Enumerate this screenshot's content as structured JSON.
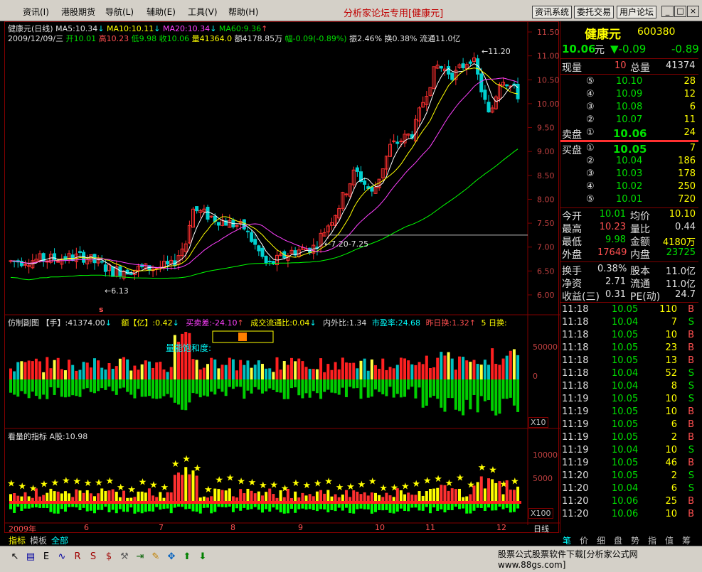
{
  "menu": {
    "items": [
      "资讯(I)",
      "港股期货",
      "导航(L)",
      "辅助(E)",
      "工具(V)",
      "帮助(H)"
    ],
    "app_title": "分析家论坛专用",
    "app_title_stock": "[健康元]",
    "buttons": [
      "资讯系统",
      "委托交易",
      "用户论坛"
    ],
    "win_controls": [
      "_",
      "□",
      "×"
    ]
  },
  "colors": {
    "up": "#ff3030",
    "down": "#00d0d0",
    "ma5": "#ffffff",
    "ma10": "#ffff00",
    "ma20": "#ff40ff",
    "ma60": "#00ff00",
    "grid": "#800000"
  },
  "chart": {
    "title_line": "健康元(日线)",
    "ma5": "MA5:10.34",
    "ma10": "MA10:10.11",
    "ma20": "MA20:10.34",
    "ma60": "MA60:9.36",
    "date": "2009/12/09/三",
    "open": "开10.01",
    "high": "高10.23",
    "low": "低9.98",
    "close": "收10.06",
    "volume": "量41364.0",
    "amount": "额4178.85万",
    "change": "幅-0.09(-0.89%)",
    "amp": "振2.46%",
    "turnover": "换0.38%",
    "float": "流通11.0亿",
    "price_ticks": [
      "11.50",
      "11.00",
      "10.50",
      "10.00",
      "9.50",
      "9.00",
      "8.50",
      "8.00",
      "7.50",
      "7.00",
      "6.50",
      "6.00"
    ],
    "annot_high": "11.20",
    "annot_low": "6.13",
    "annot_range": "7.20-7.25",
    "marker": "s"
  },
  "sub1": {
    "name": "仿制副图",
    "unit": "【手】",
    "vol": ":41374.00",
    "amt_label": "额【亿】",
    "amt": ":0.42",
    "diff": "买卖差:-24.10",
    "flow": "成交流通比:0.04",
    "inout": "内外比:1.34",
    "pe": "市盈率:24.68",
    "turn": "昨日换:1.32",
    "five": "5 日换:",
    "saturation": "量能饱和度:",
    "ticks": [
      "50000",
      "0"
    ],
    "scale": "X10"
  },
  "sub2": {
    "name": "看量的指标",
    "ashare": "A股:10.98",
    "ticks": [
      "10000",
      "5000"
    ],
    "scale": "X100"
  },
  "timeaxis": [
    "2009年",
    "6",
    "7",
    "8",
    "9",
    "10",
    "11",
    "12"
  ],
  "period": "日线",
  "bottom_tabs": [
    "指标",
    "模板",
    "全部"
  ],
  "quote": {
    "name": "健康元",
    "code": "600380",
    "price": "10.06",
    "unit": "元",
    "change": "▼-0.09",
    "pct": "-0.89",
    "now_vol_label": "现量",
    "now_vol": "10",
    "total_label": "总量",
    "total": "41374",
    "asks": [
      {
        "lvl": "⑤",
        "price": "10.10",
        "vol": "28"
      },
      {
        "lvl": "④",
        "price": "10.09",
        "vol": "12"
      },
      {
        "lvl": "③",
        "price": "10.08",
        "vol": "6"
      },
      {
        "lvl": "②",
        "price": "10.07",
        "vol": "11"
      },
      {
        "lvl": "①",
        "price": "10.06",
        "vol": "24"
      }
    ],
    "ask_label": "卖盘",
    "bid_label": "买盘",
    "bids": [
      {
        "lvl": "①",
        "price": "10.05",
        "vol": "7"
      },
      {
        "lvl": "②",
        "price": "10.04",
        "vol": "186"
      },
      {
        "lvl": "③",
        "price": "10.03",
        "vol": "178"
      },
      {
        "lvl": "④",
        "price": "10.02",
        "vol": "250"
      },
      {
        "lvl": "⑤",
        "price": "10.01",
        "vol": "720"
      }
    ],
    "stats": [
      {
        "l1": "今开",
        "v1": "10.01",
        "l2": "均价",
        "v2": "10.10"
      },
      {
        "l1": "最高",
        "v1": "10.23",
        "l2": "量比",
        "v2": "0.44"
      },
      {
        "l1": "最低",
        "v1": "9.98",
        "l2": "金额",
        "v2": "4180万"
      },
      {
        "l1": "外盘",
        "v1": "17649",
        "l2": "内盘",
        "v2": "23725"
      }
    ],
    "stats2": [
      {
        "l1": "换手",
        "v1": "0.38%",
        "l2": "股本",
        "v2": "11.0亿"
      },
      {
        "l1": "净资",
        "v1": "2.71",
        "l2": "流通",
        "v2": "11.0亿"
      },
      {
        "l1": "收益(三)",
        "v1": "0.31",
        "l2": "PE(动)",
        "v2": "24.7"
      }
    ],
    "ticks": [
      {
        "t": "11:18",
        "p": "10.05",
        "v": "110",
        "s": "B"
      },
      {
        "t": "11:18",
        "p": "10.04",
        "v": "7",
        "s": "S"
      },
      {
        "t": "11:18",
        "p": "10.05",
        "v": "10",
        "s": "B"
      },
      {
        "t": "11:18",
        "p": "10.05",
        "v": "23",
        "s": "B"
      },
      {
        "t": "11:18",
        "p": "10.05",
        "v": "13",
        "s": "B"
      },
      {
        "t": "11:18",
        "p": "10.04",
        "v": "52",
        "s": "S"
      },
      {
        "t": "11:18",
        "p": "10.04",
        "v": "8",
        "s": "S"
      },
      {
        "t": "11:19",
        "p": "10.05",
        "v": "10",
        "s": "S"
      },
      {
        "t": "11:19",
        "p": "10.05",
        "v": "10",
        "s": "B"
      },
      {
        "t": "11:19",
        "p": "10.05",
        "v": "6",
        "s": "B"
      },
      {
        "t": "11:19",
        "p": "10.05",
        "v": "2",
        "s": "B"
      },
      {
        "t": "11:19",
        "p": "10.04",
        "v": "10",
        "s": "S"
      },
      {
        "t": "11:19",
        "p": "10.05",
        "v": "46",
        "s": "B"
      },
      {
        "t": "11:20",
        "p": "10.05",
        "v": "2",
        "s": "S"
      },
      {
        "t": "11:20",
        "p": "10.04",
        "v": "6",
        "s": "S"
      },
      {
        "t": "11:20",
        "p": "10.06",
        "v": "25",
        "s": "B"
      },
      {
        "t": "11:20",
        "p": "10.06",
        "v": "10",
        "s": "B"
      }
    ],
    "side_tabs": [
      "笔",
      "价",
      "细",
      "盘",
      "势",
      "指",
      "值",
      "筹"
    ]
  },
  "footer": {
    "text": "股票公式股票软件下载[分析家公式网www.88gs.com]",
    "tool_icons": [
      "mouse-icon",
      "chart-icon",
      "etf-icon",
      "wave-icon",
      "rsi-icon",
      "ss-icon",
      "dollar-icon",
      "wrench-icon",
      "import-icon",
      "pencil-icon",
      "move-icon",
      "arrow-up-icon",
      "arrow-down-icon"
    ]
  }
}
